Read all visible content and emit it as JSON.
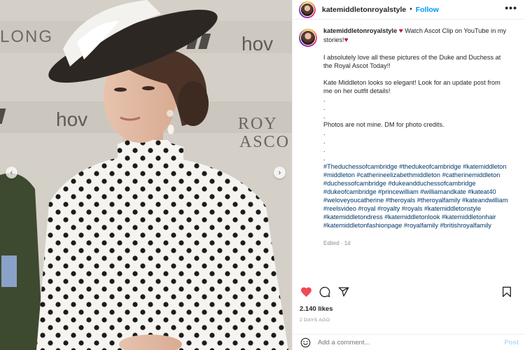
{
  "photo": {
    "alt_signage": [
      "LONG",
      "hov",
      "hov",
      "ROY",
      "ASCO"
    ]
  },
  "header": {
    "username": "katemiddletonroyalstyle",
    "separator": "•",
    "follow_label": "Follow",
    "more_label": "•••"
  },
  "caption": {
    "username": "katemiddletonroyalstyle",
    "heart": "♥",
    "line1": "Watch Ascot Clip on YouTube in my stories!",
    "para1": "I absolutely love all these pictures of the Duke and Duchess at the Royal Ascot Today!!",
    "para2": "Kate Middleton looks so elegant! Look for an update post from me on her outfit details!",
    "dot": ".",
    "credits": "Photos are not mine. DM for photo credits.",
    "hashtags": "#Theduchessofcambridge #theduke​ofcambridge #katemiddleton #middleton #catherineelizabethmiddleton #catherinemiddleton #duchessofcambridge #dukeandduchessofcambridge #dukeofcambridge #princewilliam #williamandkate #kateat40 #weloveyoucatherine #theroyals #theroyalfamily #kateandwilliam #reelsvideo #royal #royalty #royals #katemiddletonstyle #katemiddletondress #katemiddletonlook #katemiddletonhair #katemiddletonfashionpage #royalfamily #britishroyalfamily",
    "edited": "Edited · 1d"
  },
  "actions": {
    "like_icon": "heart-icon",
    "comment_icon": "comment-icon",
    "share_icon": "share-icon",
    "save_icon": "bookmark-icon",
    "like_color": "#ed4956"
  },
  "stats": {
    "likes": "2.140 likes",
    "time": "2 DAYS AGO"
  },
  "comment": {
    "placeholder": "Add a comment...",
    "post_label": "Post"
  }
}
